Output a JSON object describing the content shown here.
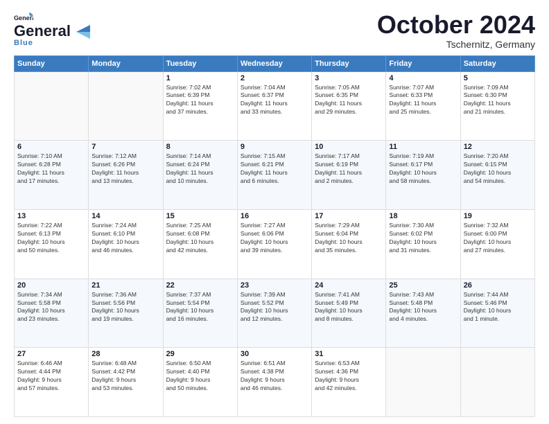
{
  "header": {
    "logo_line1": "General",
    "logo_line2": "Blue",
    "month": "October 2024",
    "location": "Tschernitz, Germany"
  },
  "weekdays": [
    "Sunday",
    "Monday",
    "Tuesday",
    "Wednesday",
    "Thursday",
    "Friday",
    "Saturday"
  ],
  "weeks": [
    [
      {
        "day": "",
        "info": ""
      },
      {
        "day": "",
        "info": ""
      },
      {
        "day": "1",
        "info": "Sunrise: 7:02 AM\nSunset: 6:39 PM\nDaylight: 11 hours\nand 37 minutes."
      },
      {
        "day": "2",
        "info": "Sunrise: 7:04 AM\nSunset: 6:37 PM\nDaylight: 11 hours\nand 33 minutes."
      },
      {
        "day": "3",
        "info": "Sunrise: 7:05 AM\nSunset: 6:35 PM\nDaylight: 11 hours\nand 29 minutes."
      },
      {
        "day": "4",
        "info": "Sunrise: 7:07 AM\nSunset: 6:33 PM\nDaylight: 11 hours\nand 25 minutes."
      },
      {
        "day": "5",
        "info": "Sunrise: 7:09 AM\nSunset: 6:30 PM\nDaylight: 11 hours\nand 21 minutes."
      }
    ],
    [
      {
        "day": "6",
        "info": "Sunrise: 7:10 AM\nSunset: 6:28 PM\nDaylight: 11 hours\nand 17 minutes."
      },
      {
        "day": "7",
        "info": "Sunrise: 7:12 AM\nSunset: 6:26 PM\nDaylight: 11 hours\nand 13 minutes."
      },
      {
        "day": "8",
        "info": "Sunrise: 7:14 AM\nSunset: 6:24 PM\nDaylight: 11 hours\nand 10 minutes."
      },
      {
        "day": "9",
        "info": "Sunrise: 7:15 AM\nSunset: 6:21 PM\nDaylight: 11 hours\nand 6 minutes."
      },
      {
        "day": "10",
        "info": "Sunrise: 7:17 AM\nSunset: 6:19 PM\nDaylight: 11 hours\nand 2 minutes."
      },
      {
        "day": "11",
        "info": "Sunrise: 7:19 AM\nSunset: 6:17 PM\nDaylight: 10 hours\nand 58 minutes."
      },
      {
        "day": "12",
        "info": "Sunrise: 7:20 AM\nSunset: 6:15 PM\nDaylight: 10 hours\nand 54 minutes."
      }
    ],
    [
      {
        "day": "13",
        "info": "Sunrise: 7:22 AM\nSunset: 6:13 PM\nDaylight: 10 hours\nand 50 minutes."
      },
      {
        "day": "14",
        "info": "Sunrise: 7:24 AM\nSunset: 6:10 PM\nDaylight: 10 hours\nand 46 minutes."
      },
      {
        "day": "15",
        "info": "Sunrise: 7:25 AM\nSunset: 6:08 PM\nDaylight: 10 hours\nand 42 minutes."
      },
      {
        "day": "16",
        "info": "Sunrise: 7:27 AM\nSunset: 6:06 PM\nDaylight: 10 hours\nand 39 minutes."
      },
      {
        "day": "17",
        "info": "Sunrise: 7:29 AM\nSunset: 6:04 PM\nDaylight: 10 hours\nand 35 minutes."
      },
      {
        "day": "18",
        "info": "Sunrise: 7:30 AM\nSunset: 6:02 PM\nDaylight: 10 hours\nand 31 minutes."
      },
      {
        "day": "19",
        "info": "Sunrise: 7:32 AM\nSunset: 6:00 PM\nDaylight: 10 hours\nand 27 minutes."
      }
    ],
    [
      {
        "day": "20",
        "info": "Sunrise: 7:34 AM\nSunset: 5:58 PM\nDaylight: 10 hours\nand 23 minutes."
      },
      {
        "day": "21",
        "info": "Sunrise: 7:36 AM\nSunset: 5:56 PM\nDaylight: 10 hours\nand 19 minutes."
      },
      {
        "day": "22",
        "info": "Sunrise: 7:37 AM\nSunset: 5:54 PM\nDaylight: 10 hours\nand 16 minutes."
      },
      {
        "day": "23",
        "info": "Sunrise: 7:39 AM\nSunset: 5:52 PM\nDaylight: 10 hours\nand 12 minutes."
      },
      {
        "day": "24",
        "info": "Sunrise: 7:41 AM\nSunset: 5:49 PM\nDaylight: 10 hours\nand 8 minutes."
      },
      {
        "day": "25",
        "info": "Sunrise: 7:43 AM\nSunset: 5:48 PM\nDaylight: 10 hours\nand 4 minutes."
      },
      {
        "day": "26",
        "info": "Sunrise: 7:44 AM\nSunset: 5:46 PM\nDaylight: 10 hours\nand 1 minute."
      }
    ],
    [
      {
        "day": "27",
        "info": "Sunrise: 6:46 AM\nSunset: 4:44 PM\nDaylight: 9 hours\nand 57 minutes."
      },
      {
        "day": "28",
        "info": "Sunrise: 6:48 AM\nSunset: 4:42 PM\nDaylight: 9 hours\nand 53 minutes."
      },
      {
        "day": "29",
        "info": "Sunrise: 6:50 AM\nSunset: 4:40 PM\nDaylight: 9 hours\nand 50 minutes."
      },
      {
        "day": "30",
        "info": "Sunrise: 6:51 AM\nSunset: 4:38 PM\nDaylight: 9 hours\nand 46 minutes."
      },
      {
        "day": "31",
        "info": "Sunrise: 6:53 AM\nSunset: 4:36 PM\nDaylight: 9 hours\nand 42 minutes."
      },
      {
        "day": "",
        "info": ""
      },
      {
        "day": "",
        "info": ""
      }
    ]
  ]
}
